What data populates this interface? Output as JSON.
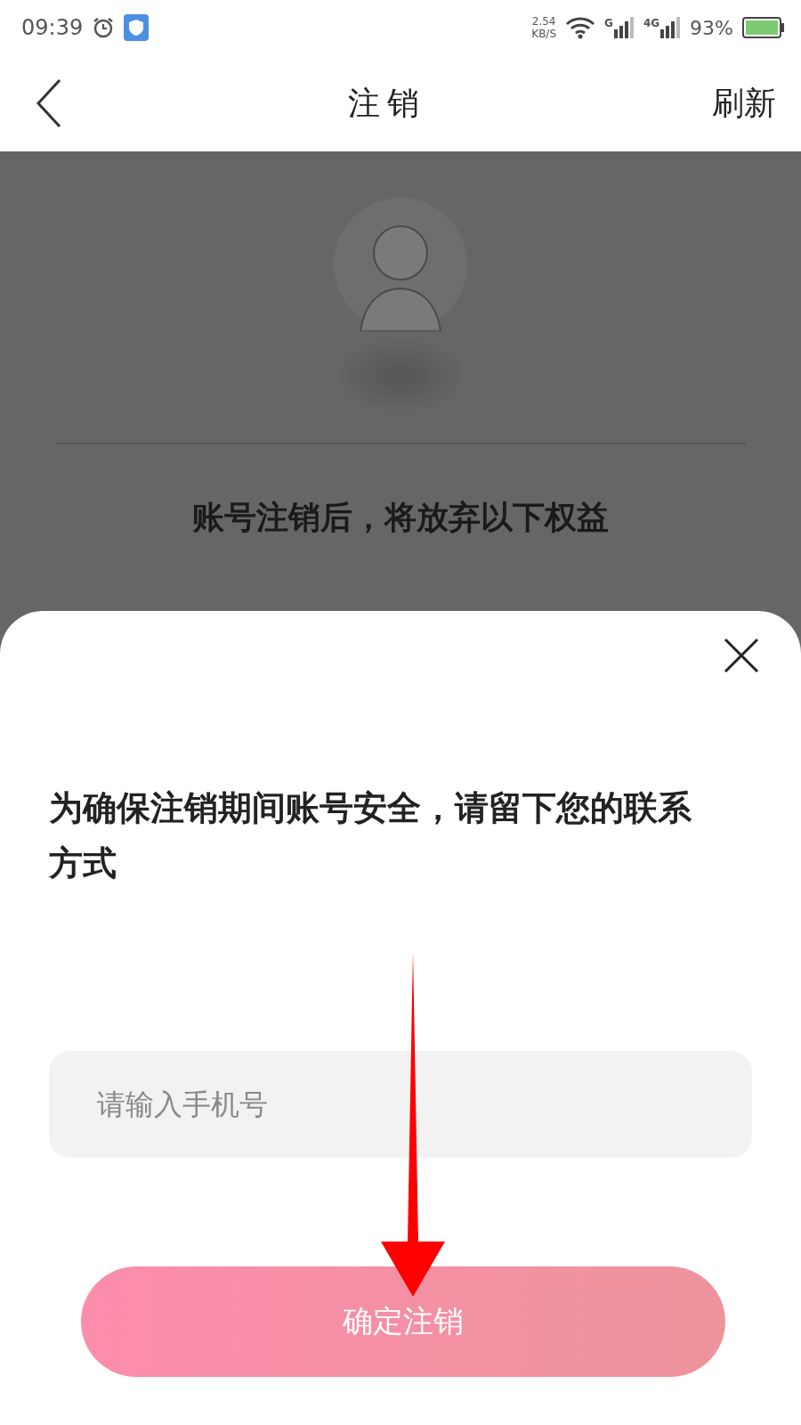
{
  "status_bar": {
    "time": "09:39",
    "speed": "2.54",
    "speed_unit": "KB/S",
    "sim_1": "G",
    "sim_2": "4G",
    "battery": "93%"
  },
  "header": {
    "title": "注销",
    "action": "刷新"
  },
  "background": {
    "heading": "账号注销后，将放弃以下权益"
  },
  "sheet": {
    "message": "为确保注销期间账号安全，请留下您的联系方式",
    "phone": {
      "placeholder": "请输入手机号"
    },
    "confirm_button": "确定注销"
  }
}
